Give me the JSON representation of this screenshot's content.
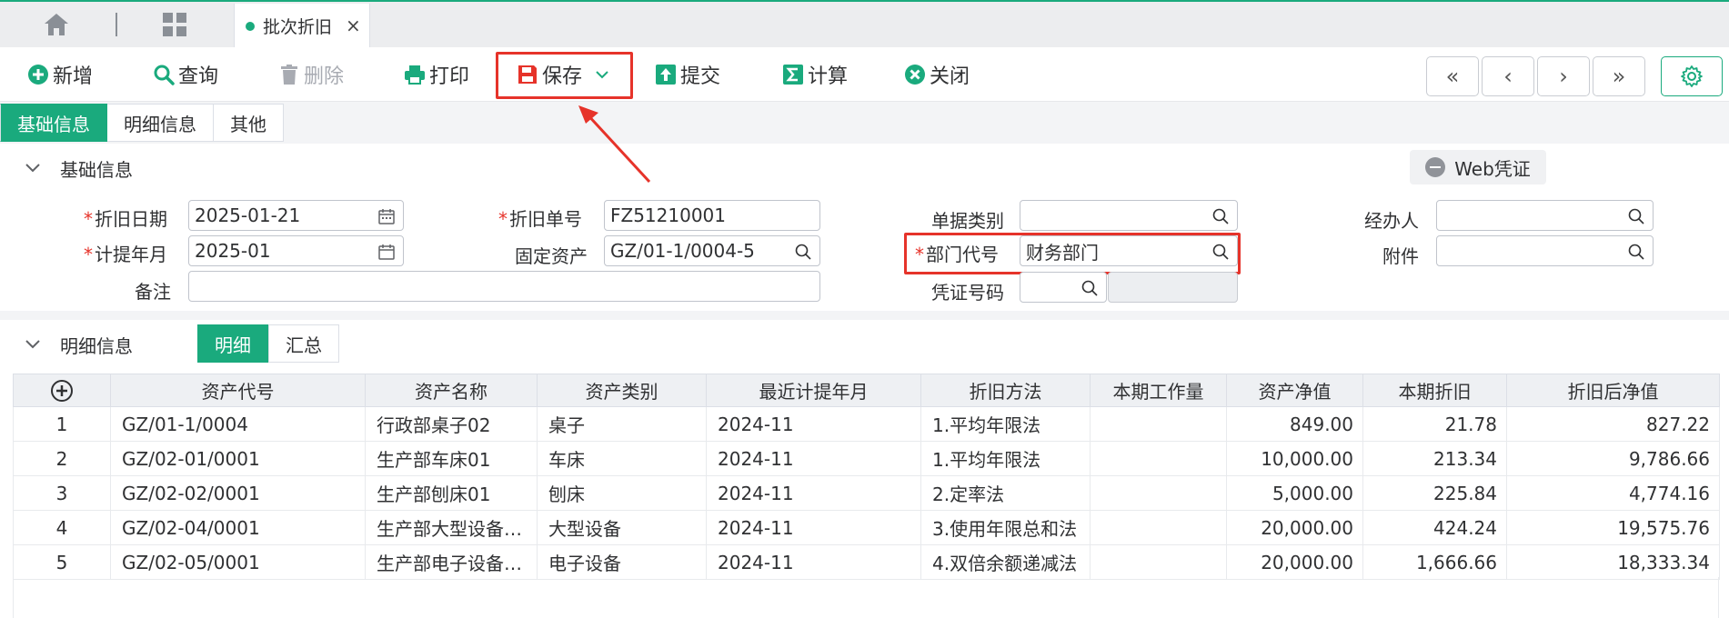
{
  "tabbar": {
    "active_tab": "批次折旧",
    "close_glyph": "×"
  },
  "toolbar": {
    "add": "新增",
    "query": "查询",
    "delete": "删除",
    "print": "打印",
    "save": "保存",
    "submit": "提交",
    "calc": "计算",
    "close": "关闭",
    "nav": [
      "«",
      "‹",
      "›",
      "»"
    ]
  },
  "subtabs": [
    "基础信息",
    "明细信息",
    "其他"
  ],
  "basic": {
    "title": "基础信息",
    "web_voucher": "Web凭证",
    "fields": {
      "dep_date_label": "折旧日期",
      "dep_date": "2025-01-21",
      "dep_no_label": "折旧单号",
      "dep_no": "FZ51210001",
      "doc_type_label": "单据类别",
      "doc_type": "",
      "handler_label": "经办人",
      "handler": "",
      "period_label": "计提年月",
      "period": "2025-01",
      "asset_label": "固定资产",
      "asset": "GZ/01-1/0004-5",
      "dept_label": "部门代号",
      "dept": "财务部门",
      "attach_label": "附件",
      "attach": "",
      "remark_label": "备注",
      "remark": "",
      "voucher_label": "凭证号码",
      "voucher": ""
    }
  },
  "detail": {
    "title": "明细信息",
    "seg": [
      "明细",
      "汇总"
    ],
    "columns": [
      "资产代号",
      "资产名称",
      "资产类别",
      "最近计提年月",
      "折旧方法",
      "本期工作量",
      "资产净值",
      "本期折旧",
      "折旧后净值"
    ],
    "rows": [
      [
        "1",
        "GZ/01-1/0004",
        "行政部桌子02",
        "桌子",
        "2024-11",
        "1.平均年限法",
        "",
        "849.00",
        "21.78",
        "827.22"
      ],
      [
        "2",
        "GZ/02-01/0001",
        "生产部车床01",
        "车床",
        "2024-11",
        "1.平均年限法",
        "",
        "10,000.00",
        "213.34",
        "9,786.66"
      ],
      [
        "3",
        "GZ/02-02/0001",
        "生产部刨床01",
        "刨床",
        "2024-11",
        "2.定率法",
        "",
        "5,000.00",
        "225.84",
        "4,774.16"
      ],
      [
        "4",
        "GZ/02-04/0001",
        "生产部大型设备…",
        "大型设备",
        "2024-11",
        "3.使用年限总和法",
        "",
        "20,000.00",
        "424.24",
        "19,575.76"
      ],
      [
        "5",
        "GZ/02-05/0001",
        "生产部电子设备…",
        "电子设备",
        "2024-11",
        "4.双倍余额递减法",
        "",
        "20,000.00",
        "1,666.66",
        "18,333.34"
      ]
    ]
  },
  "colors": {
    "accent": "#1aaa7d",
    "highlight": "#e6332a"
  }
}
